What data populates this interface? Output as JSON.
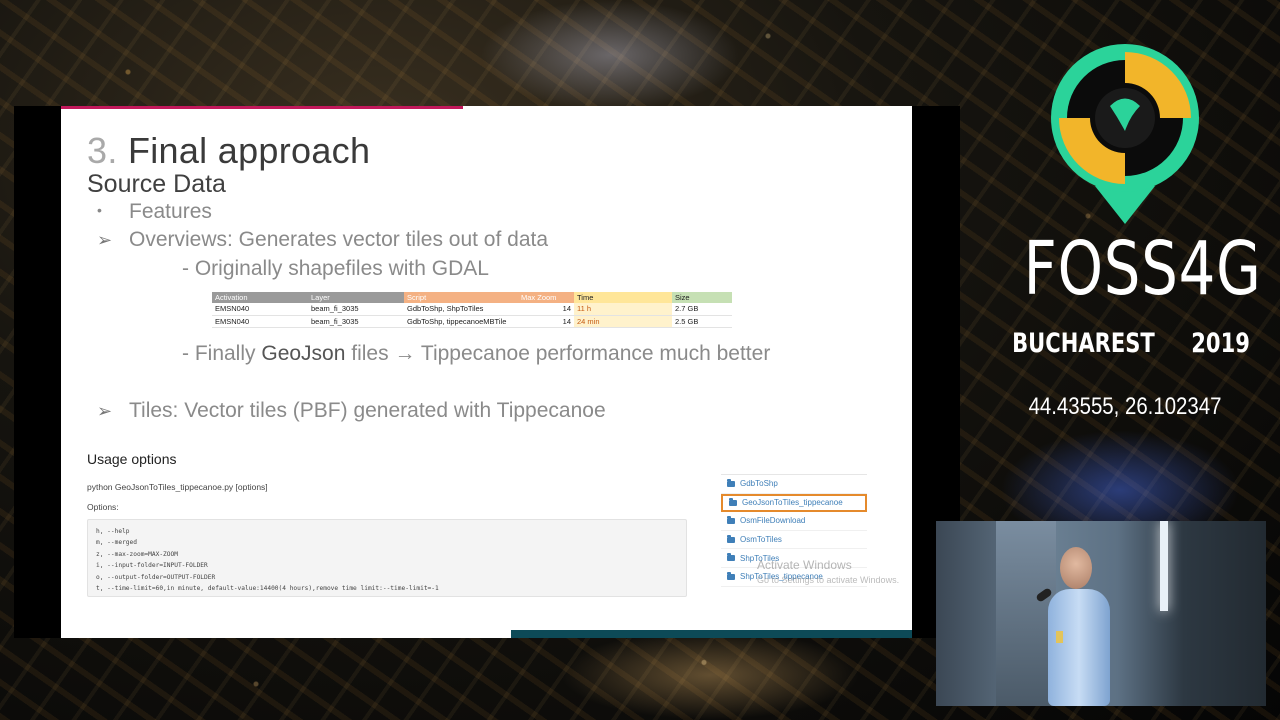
{
  "slide": {
    "title_number": "3.",
    "title_text": "Final approach",
    "subtitle": "Source Data",
    "bullet_features": "Features",
    "arrow_overviews": "Overviews: Generates vector tiles out of data",
    "dash_originally": "- Originally shapefiles with GDAL",
    "table": {
      "headers": [
        "Activation",
        "Layer",
        "Script",
        "Max Zoom",
        "Time",
        "Size"
      ],
      "rows": [
        [
          "EMSN040",
          "beam_fi_3035",
          "GdbToShp, ShpToTiles",
          "14",
          "11 h",
          "2.7 GB"
        ],
        [
          "EMSN040",
          "beam_fi_3035",
          "GdbToShp, tippecanoeMBTile",
          "14",
          "24 min",
          "2.5 GB"
        ]
      ]
    },
    "dash_finally_prefix": "- Finally",
    "dash_finally_geojson": "GeoJson",
    "dash_finally_suffix": "files → Tippecanoe performance much better",
    "arrow_tiles": "Tiles: Vector tiles (PBF) generated with Tippecanoe",
    "usage_title": "Usage options",
    "usage_command": "python GeoJsonToTiles_tippecanoe.py [options]",
    "usage_options_label": "Options:",
    "code_lines": [
      "h, --help",
      "m, --merged",
      "z, --max-zoom=MAX-ZOOM",
      "i, --input-folder=INPUT-FOLDER",
      "o, --output-folder=OUTPUT-FOLDER",
      "t, --time-limit=60,in minute, default-value:14400(4 hours),remove time limit:--time-limit=-1"
    ],
    "folders": [
      {
        "label": "GdbToShp",
        "selected": false
      },
      {
        "label": "GeoJsonToTiles_tippecanoe",
        "selected": true
      },
      {
        "label": "OsmFileDownload",
        "selected": false
      },
      {
        "label": "OsmToTiles",
        "selected": false
      },
      {
        "label": "ShpToTiles",
        "selected": false
      },
      {
        "label": "ShpToTiles_tippecanoe",
        "selected": false
      }
    ],
    "watermark_title": "Activate Windows",
    "watermark_sub": "Go to Settings to activate Windows."
  },
  "branding": {
    "event": "FOSS4G",
    "city": "BUCHAREST",
    "year": "2019",
    "coordinates": "44.43555, 26.102347",
    "colors": {
      "logo_green": "#2bd39a",
      "logo_yellow": "#f2b52a",
      "accent_pink": "#c2185b",
      "accent_teal": "#0d4a57"
    }
  }
}
